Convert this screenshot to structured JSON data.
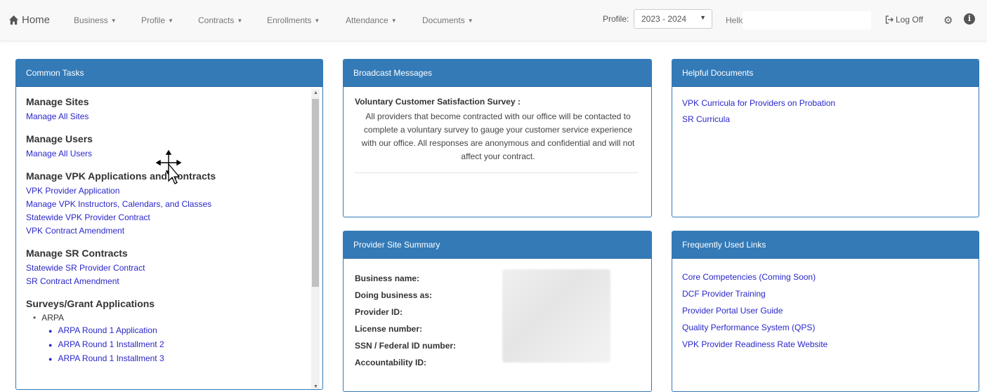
{
  "navbar": {
    "home_label": "Home",
    "menus": [
      "Business",
      "Profile",
      "Contracts",
      "Enrollments",
      "Attendance",
      "Documents"
    ],
    "profile_label": "Profile:",
    "profile_selected": "2023 - 2024",
    "hello_label": "Hello",
    "hello_value": "",
    "logoff_label": "Log Off"
  },
  "common_tasks": {
    "title": "Common Tasks",
    "sections": [
      {
        "title": "Manage Sites",
        "links": [
          "Manage All Sites"
        ]
      },
      {
        "title": "Manage Users",
        "links": [
          "Manage All Users"
        ]
      },
      {
        "title": "Manage VPK Applications and Contracts",
        "links": [
          "VPK Provider Application",
          "Manage VPK Instructors, Calendars, and Classes",
          "Statewide VPK Provider Contract",
          "VPK Contract Amendment"
        ]
      },
      {
        "title": "Manage SR Contracts",
        "links": [
          "Statewide SR Provider Contract",
          "SR Contract Amendment"
        ]
      }
    ],
    "surveys": {
      "title": "Surveys/Grant Applications",
      "group": "ARPA",
      "links": [
        "ARPA Round 1 Application",
        "ARPA Round 1 Installment 2",
        "ARPA Round 1 Installment 3"
      ]
    }
  },
  "broadcast": {
    "title": "Broadcast Messages",
    "message_title": "Voluntary Customer Satisfaction Survey :",
    "message_body": "All providers that become contracted with our office will be contacted to complete a voluntary survey to gauge your customer service experience with our office. All responses are anonymous and confidential and will not affect your contract."
  },
  "helpful": {
    "title": "Helpful Documents",
    "links": [
      "VPK Curricula for Providers on Probation",
      "SR Curricula"
    ]
  },
  "provider": {
    "title": "Provider Site Summary",
    "fields": [
      "Business name:",
      "Doing business as:",
      "Provider ID:",
      "License number:",
      "SSN / Federal ID number:",
      "Accountability ID:"
    ]
  },
  "frequent": {
    "title": "Frequently Used Links",
    "links": [
      "Core Competencies (Coming Soon)",
      "DCF Provider Training",
      "Provider Portal User Guide",
      "Quality Performance System (QPS)",
      "VPK Provider Readiness Rate Website"
    ]
  },
  "icons": {
    "home": "home-icon",
    "logoff": "logoff-icon",
    "settings": "gear-icon",
    "info": "info-icon",
    "cursor": "move-cursor-icon"
  },
  "colors": {
    "panel_header": "#337ab7",
    "link": "#2a27c9",
    "navbar_bg": "#f8f8f8"
  }
}
